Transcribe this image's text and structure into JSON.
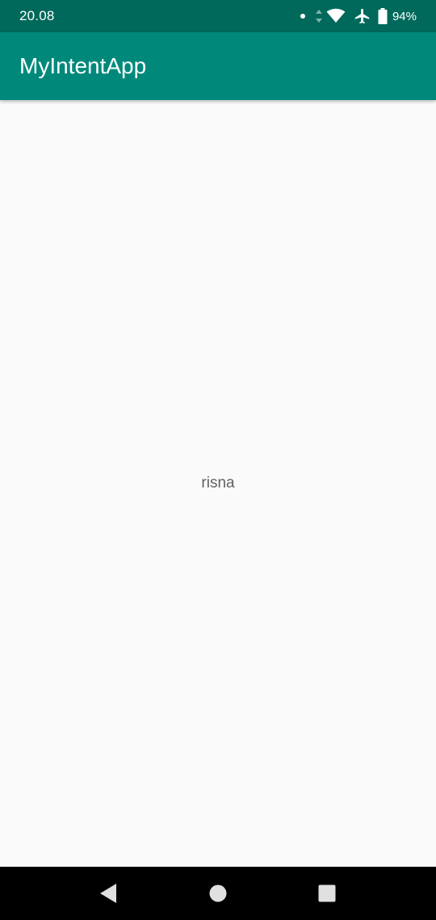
{
  "status_bar": {
    "time": "20.08",
    "battery_percent": "94%",
    "icons": [
      "notification-dot-icon",
      "data-arrows-icon",
      "wifi-icon",
      "airplane-mode-icon",
      "battery-icon"
    ]
  },
  "app_bar": {
    "title": "MyIntentApp",
    "color": "#00897b",
    "status_color": "#00695c"
  },
  "main": {
    "text": "risna"
  },
  "nav_bar": {
    "buttons": [
      "back-icon",
      "home-icon",
      "recents-icon"
    ]
  }
}
